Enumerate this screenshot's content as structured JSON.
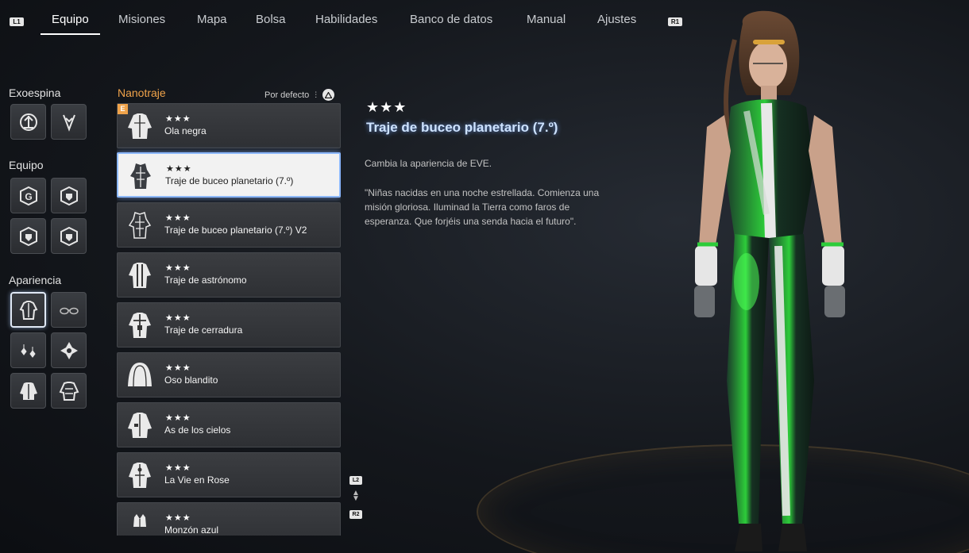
{
  "nav": {
    "left_button": "L1",
    "right_button": "R1",
    "tabs": [
      {
        "label": "Equipo",
        "active": true
      },
      {
        "label": "Misiones",
        "active": false
      },
      {
        "label": "Mapa",
        "active": false
      },
      {
        "label": "Bolsa",
        "active": false
      },
      {
        "label": "Habilidades",
        "active": false
      },
      {
        "label": "Banco de datos",
        "active": false
      },
      {
        "label": "Manual",
        "active": false
      },
      {
        "label": "Ajustes",
        "active": false
      }
    ]
  },
  "categories": {
    "exoespina": {
      "title": "Exoespina",
      "slots": [
        "exospine-slot-1",
        "exospine-slot-2"
      ]
    },
    "equipo": {
      "title": "Equipo",
      "slots": [
        "gear-g-slot",
        "gear-shield-slot-1",
        "gear-shield-slot-2",
        "gear-shield-slot-3"
      ]
    },
    "apariencia": {
      "title": "Apariencia",
      "slots": [
        "suit-slot",
        "glasses-slot",
        "earrings-slot",
        "hairstyle-slot",
        "jacket-slot",
        "drone-outfit-slot"
      ]
    }
  },
  "list": {
    "title": "Nanotraje",
    "sort_label": "Por defecto",
    "sort_button_icon": "triangle-icon",
    "equipped_badge": "E",
    "items": [
      {
        "stars": "★★★",
        "name": "Ola negra",
        "equipped": true,
        "selected": false
      },
      {
        "stars": "★★★",
        "name": "Traje de buceo planetario (7.º)",
        "equipped": false,
        "selected": true
      },
      {
        "stars": "★★★",
        "name": "Traje de buceo planetario (7.º) V2",
        "equipped": false,
        "selected": false
      },
      {
        "stars": "★★★",
        "name": "Traje de astrónomo",
        "equipped": false,
        "selected": false
      },
      {
        "stars": "★★★",
        "name": "Traje de cerradura",
        "equipped": false,
        "selected": false
      },
      {
        "stars": "★★★",
        "name": "Oso blandito",
        "equipped": false,
        "selected": false
      },
      {
        "stars": "★★★",
        "name": "As de los cielos",
        "equipped": false,
        "selected": false
      },
      {
        "stars": "★★★",
        "name": "La Vie en Rose",
        "equipped": false,
        "selected": false
      },
      {
        "stars": "★★★",
        "name": "Monzón azul",
        "equipped": false,
        "selected": false
      }
    ],
    "scroll_up_button": "L2",
    "scroll_down_button": "R2"
  },
  "detail": {
    "stars": "★★★",
    "title": "Traje de buceo planetario (7.º)",
    "effect": "Cambia la apariencia de EVE.",
    "quote": "\"Niñas nacidas en una noche estrellada. Comienza una misión gloriosa. Iluminad la Tierra como faros de esperanza. Que forjéis una senda hacia el futuro\"."
  },
  "colors": {
    "accent_orange": "#f0a34a",
    "selected_glow": "#8cb8ff",
    "title_blue": "#cde2ff"
  }
}
